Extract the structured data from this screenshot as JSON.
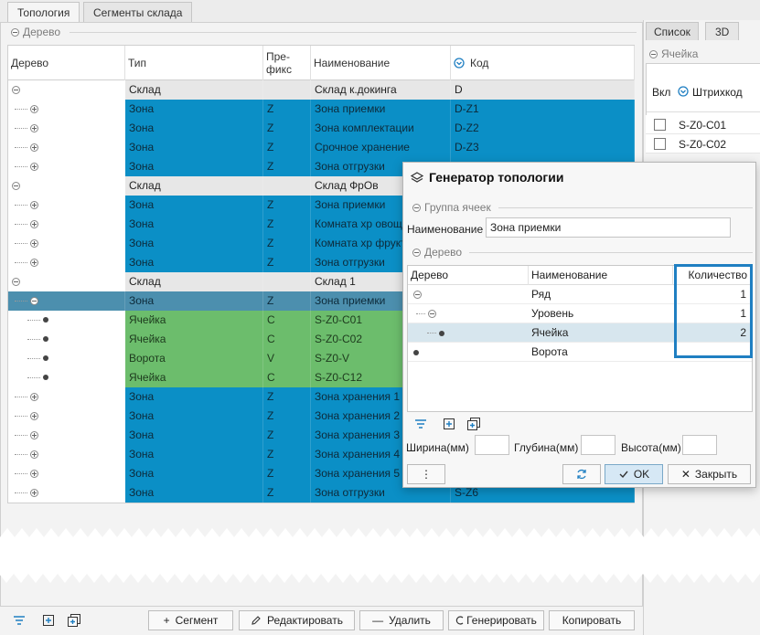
{
  "tabs": [
    {
      "label": "Топология",
      "active": true
    },
    {
      "label": "Сегменты склада",
      "active": false
    }
  ],
  "tree_section": {
    "title": "Дерево"
  },
  "grid": {
    "columns": [
      "Дерево",
      "Тип",
      "Пре-фикс",
      "Наименование",
      "Код"
    ],
    "columns_lines": {
      "prefix_1": "Пре-",
      "prefix_2": "фикс"
    },
    "rows": [
      {
        "kind": "sklad",
        "level": 0,
        "type": "Склад",
        "prefix": "",
        "name": "Склад к.докинга",
        "code": "D"
      },
      {
        "kind": "zona",
        "level": 1,
        "type": "Зона",
        "prefix": "Z",
        "name": "Зона приемки",
        "code": "D-Z1"
      },
      {
        "kind": "zona",
        "level": 1,
        "type": "Зона",
        "prefix": "Z",
        "name": "Зона комплектации",
        "code": "D-Z2"
      },
      {
        "kind": "zona",
        "level": 1,
        "type": "Зона",
        "prefix": "Z",
        "name": "Срочное хранение",
        "code": "D-Z3"
      },
      {
        "kind": "zona",
        "level": 1,
        "type": "Зона",
        "prefix": "Z",
        "name": "Зона отгрузки",
        "code": ""
      },
      {
        "kind": "sklad",
        "level": 0,
        "type": "Склад",
        "prefix": "",
        "name": "Склад ФрОв",
        "code": ""
      },
      {
        "kind": "zona",
        "level": 1,
        "type": "Зона",
        "prefix": "Z",
        "name": "Зона приемки",
        "code": ""
      },
      {
        "kind": "zona",
        "level": 1,
        "type": "Зона",
        "prefix": "Z",
        "name": "Комната хр овощ",
        "code": ""
      },
      {
        "kind": "zona",
        "level": 1,
        "type": "Зона",
        "prefix": "Z",
        "name": "Комната хр фрукт",
        "code": ""
      },
      {
        "kind": "zona",
        "level": 1,
        "type": "Зона",
        "prefix": "Z",
        "name": "Зона отгрузки",
        "code": ""
      },
      {
        "kind": "sklad",
        "level": 0,
        "type": "Склад",
        "prefix": "",
        "name": "Склад 1",
        "code": ""
      },
      {
        "kind": "sel",
        "level": 1,
        "type": "Зона",
        "prefix": "Z",
        "name": "Зона приемки",
        "code": ""
      },
      {
        "kind": "green",
        "level": 2,
        "type": "Ячейка",
        "prefix": "C",
        "name": "S-Z0-C01",
        "code": ""
      },
      {
        "kind": "green",
        "level": 2,
        "type": "Ячейка",
        "prefix": "C",
        "name": "S-Z0-C02",
        "code": ""
      },
      {
        "kind": "green",
        "level": 2,
        "type": "Ворота",
        "prefix": "V",
        "name": "S-Z0-V",
        "code": ""
      },
      {
        "kind": "green",
        "level": 2,
        "type": "Ячейка",
        "prefix": "C",
        "name": "S-Z0-C12",
        "code": ""
      },
      {
        "kind": "zona",
        "level": 1,
        "type": "Зона",
        "prefix": "Z",
        "name": "Зона хранения 1",
        "code": ""
      },
      {
        "kind": "zona",
        "level": 1,
        "type": "Зона",
        "prefix": "Z",
        "name": "Зона хранения 2",
        "code": ""
      },
      {
        "kind": "zona",
        "level": 1,
        "type": "Зона",
        "prefix": "Z",
        "name": "Зона хранения 3",
        "code": ""
      },
      {
        "kind": "zona",
        "level": 1,
        "type": "Зона",
        "prefix": "Z",
        "name": "Зона хранения 4",
        "code": ""
      },
      {
        "kind": "zona",
        "level": 1,
        "type": "Зона",
        "prefix": "Z",
        "name": "Зона хранения 5",
        "code": ""
      },
      {
        "kind": "zona",
        "level": 1,
        "type": "Зона",
        "prefix": "Z",
        "name": "Зона отгрузки",
        "code": "S-Z6"
      }
    ]
  },
  "right_panel": {
    "tabs": [
      {
        "label": "Список",
        "active": true
      },
      {
        "label": "3D",
        "active": false
      }
    ],
    "section_title": "Ячейка",
    "columns": [
      "Вкл",
      "Штрихкод"
    ],
    "rows": [
      {
        "barcode": "S-Z0-C01"
      },
      {
        "barcode": "S-Z0-C02"
      }
    ]
  },
  "dialog": {
    "title": "Генератор топологии",
    "group_title": "Группа ячеек",
    "name_label": "Наименование",
    "name_value": "Зона приемки",
    "tree_title": "Дерево",
    "columns": [
      "Дерево",
      "Наименование",
      "Количество"
    ],
    "rows": [
      {
        "level": 0,
        "name": "Ряд",
        "count": "1"
      },
      {
        "level": 1,
        "name": "Уровень",
        "count": "1"
      },
      {
        "level": 2,
        "name": "Ячейка",
        "count": "2"
      },
      {
        "level": 0,
        "name": "Ворота",
        "count": ""
      }
    ],
    "width_label": "Ширина(мм)",
    "depth_label": "Глубина(мм)",
    "height_label": "Высота(мм)",
    "ok_label": "OK",
    "close_label": "Закрыть"
  },
  "bottom_toolbar": {
    "segment": "Сегмент",
    "edit": "Редактировать",
    "delete": "Удалить",
    "generate": "Генерировать",
    "copy": "Копировать"
  },
  "colors": {
    "zone_blue": "#0b8fc6",
    "cell_green": "#6cbd6c",
    "selected": "#4c8fae",
    "highlight_border": "#1f7fc2"
  }
}
